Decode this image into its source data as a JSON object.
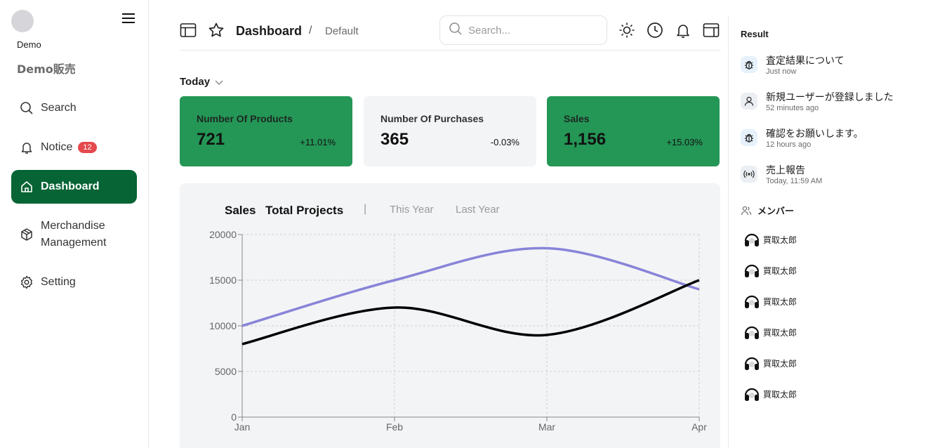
{
  "sidebar": {
    "user_name": "Demo",
    "shop_name": "Demo販売",
    "items": [
      {
        "label": "Search",
        "icon": "search-icon"
      },
      {
        "label": "Notice",
        "icon": "bell-icon",
        "badge": "12"
      },
      {
        "label": "Dashboard",
        "icon": "home-icon",
        "active": true
      },
      {
        "label": "Merchandise Management",
        "line1": "Merchandise",
        "line2": "Management",
        "icon": "box-icon"
      },
      {
        "label": "Setting",
        "icon": "gear-icon"
      }
    ]
  },
  "header": {
    "title": "Dashboard",
    "separator": "/",
    "subtitle": "Default",
    "search_placeholder": "Search..."
  },
  "period": {
    "label": "Today"
  },
  "stats": [
    {
      "label": "Number Of Products",
      "value": "721",
      "change": "+11.01%",
      "color": "#249656"
    },
    {
      "label": "Number Of Purchases",
      "value": "365",
      "change": "-0.03%",
      "color": "#f3f4f6"
    },
    {
      "label": "Sales",
      "value": "1,156",
      "change": "+15.03%",
      "color": "#249656"
    }
  ],
  "chart_tabs": {
    "tab1": "Sales",
    "tab2": "Total Projects",
    "sep": "|",
    "tab3": "This Year",
    "tab4": "Last Year"
  },
  "chart_data": {
    "type": "line",
    "categories": [
      "Jan",
      "Feb",
      "Mar",
      "Apr"
    ],
    "ylim": [
      0,
      20000
    ],
    "yticks": [
      0,
      5000,
      10000,
      15000,
      20000
    ],
    "grid": true,
    "series": [
      {
        "values": [
          10000,
          15000,
          18500,
          14000
        ],
        "color": "#8884d8"
      },
      {
        "values": [
          8000,
          12000,
          9000,
          15000
        ],
        "color": "#000000"
      }
    ]
  },
  "right_panel": {
    "title": "Result",
    "notifications": [
      {
        "text": "査定結果について",
        "time": "Just now",
        "icon": "bug-icon"
      },
      {
        "text": "新規ユーザーが登録しました",
        "time": "52 minutes ago",
        "icon": "user-icon"
      },
      {
        "text": "確認をお願いします。",
        "time": "12 hours ago",
        "icon": "bug-icon"
      },
      {
        "text": "売上報告",
        "time": "Today, 11:59 AM",
        "icon": "broadcast-icon"
      }
    ],
    "members_title": "メンバー",
    "members": [
      "買取太郎",
      "買取太郎",
      "買取太郎",
      "買取太郎",
      "買取太郎",
      "買取太郎"
    ]
  }
}
